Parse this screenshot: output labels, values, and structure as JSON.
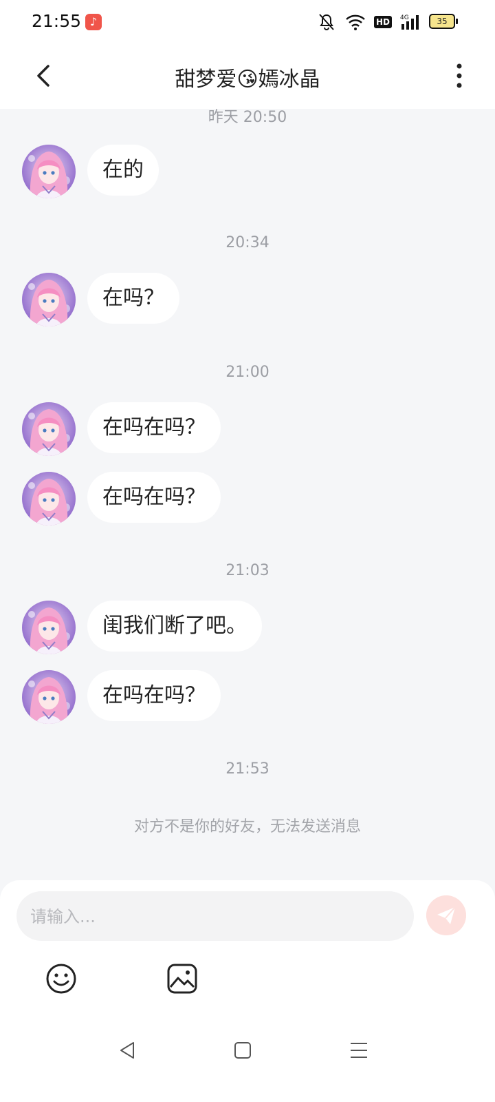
{
  "status_bar": {
    "time": "21:55",
    "app_icon": "music-note-icon",
    "hd": "HD",
    "network": "4G",
    "battery": "35"
  },
  "nav": {
    "title": "甜梦爱😘嫣冰晶",
    "back_icon": "chevron-left-icon",
    "more_icon": "more-vertical-icon"
  },
  "chat": {
    "timestamps": [
      "昨天 20:50",
      "20:34",
      "21:00",
      "21:03",
      "21:53"
    ],
    "messages": [
      "在的",
      "在吗？",
      "在吗在吗？",
      "在吗在吗？",
      "闺我们断了吧。",
      "在吗在吗？"
    ],
    "notice": "对方不是你的好友，无法发送消息"
  },
  "input": {
    "placeholder": "请输入...",
    "send_icon": "paper-plane-icon",
    "emoji_icon": "smile-icon",
    "image_icon": "image-icon"
  },
  "system_nav": {
    "back": "triangle-back-icon",
    "home": "square-home-icon",
    "menu": "menu-lines-icon"
  },
  "colors": {
    "background": "#f5f6f8",
    "bubble": "#ffffff",
    "send_button": "#fde0dd",
    "send_icon": "#ffffff"
  }
}
